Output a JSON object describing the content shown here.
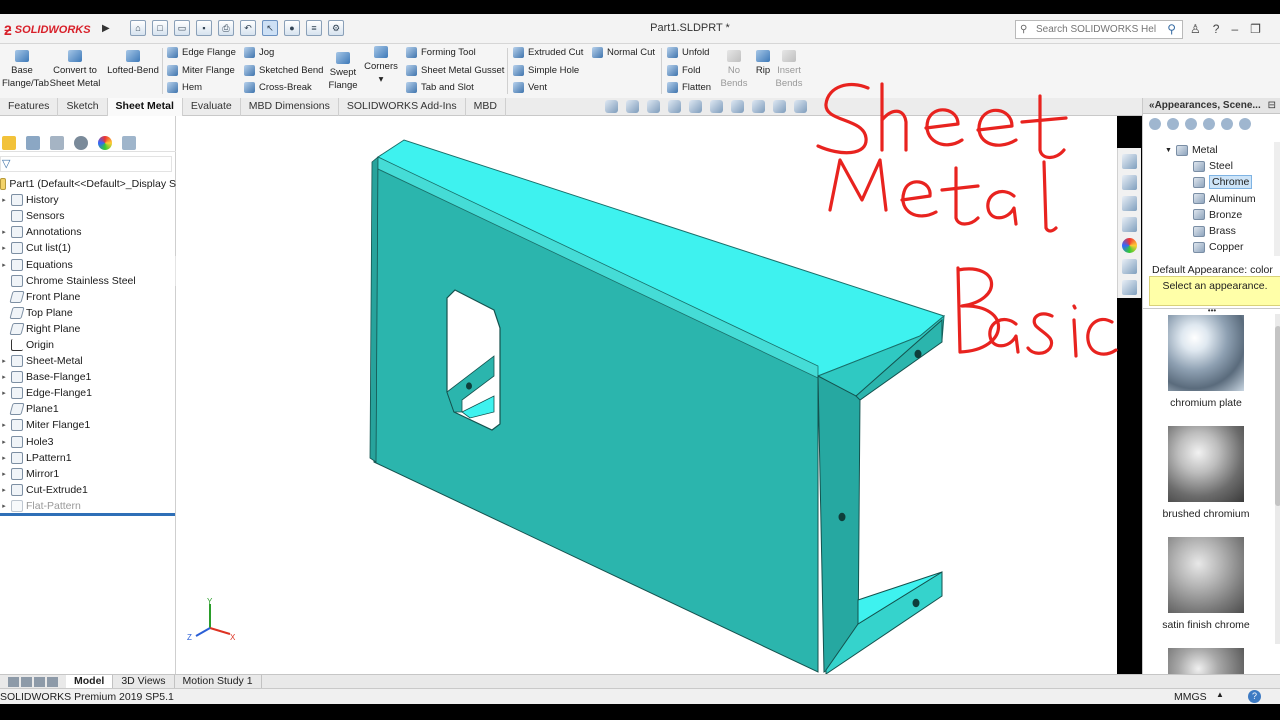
{
  "app": {
    "logo_text": "SOLIDWORKS",
    "document_title": "Part1.SLDPRT *",
    "help_search_placeholder": "Search SOLIDWORKS Help"
  },
  "ribbon": {
    "base_flange": "Base Flange/Tab",
    "convert": "Convert to Sheet Metal",
    "lofted_bend": "Lofted-Bend",
    "edge_flange": "Edge Flange",
    "miter_flange": "Miter Flange",
    "hem": "Hem",
    "jog": "Jog",
    "sketched_bend": "Sketched Bend",
    "cross_break": "Cross-Break",
    "swept_flange": "Swept Flange",
    "corners": "Corners",
    "forming_tool": "Forming Tool",
    "sheet_metal_gusset": "Sheet Metal Gusset",
    "tab_and_slot": "Tab and Slot",
    "extruded_cut": "Extruded Cut",
    "simple_hole": "Simple Hole",
    "vent": "Vent",
    "normal_cut": "Normal Cut",
    "unfold": "Unfold",
    "fold": "Fold",
    "flatten": "Flatten",
    "no_bends": "No Bends",
    "rip": "Rip",
    "insert_bends": "Insert Bends"
  },
  "command_tabs": [
    "Features",
    "Sketch",
    "Sheet Metal",
    "Evaluate",
    "MBD Dimensions",
    "SOLIDWORKS Add-Ins",
    "MBD"
  ],
  "active_command_tab": "Sheet Metal",
  "feature_tree": {
    "root": "Part1  (Default<<Default>_Display S",
    "items": [
      "History",
      "Sensors",
      "Annotations",
      "Cut list(1)",
      "Equations",
      "Chrome Stainless Steel",
      "Front Plane",
      "Top Plane",
      "Right Plane",
      "Origin",
      "Sheet-Metal",
      "Base-Flange1",
      "Edge-Flange1",
      "Plane1",
      "Miter Flange1",
      "Hole3",
      "LPattern1",
      "Mirror1",
      "Cut-Extrude1",
      "Flat-Pattern"
    ]
  },
  "appearances": {
    "header": "Appearances, Scene...",
    "tree": [
      "Metal",
      "Steel",
      "Chrome",
      "Aluminum",
      "Bronze",
      "Brass",
      "Copper"
    ],
    "selected": "Chrome",
    "info_label": "Default Appearance: color",
    "info_message": "Select an appearance.",
    "swatches": [
      "chromium plate",
      "brushed chromium",
      "satin finish chrome"
    ]
  },
  "bottom_tabs": [
    "Model",
    "3D Views",
    "Motion Study 1"
  ],
  "status": {
    "left": "SOLIDWORKS Premium 2019 SP5.1",
    "units": "MMGS"
  },
  "annotation_text": {
    "line1": "Sheet",
    "line2": "Metal",
    "line3": "Basic"
  },
  "colors": {
    "part_face": "#2bb5ad",
    "part_top": "#3ef2ef",
    "handwriting": "#e8231f",
    "brand": "#d8202a",
    "accent": "#2e6fb7"
  }
}
